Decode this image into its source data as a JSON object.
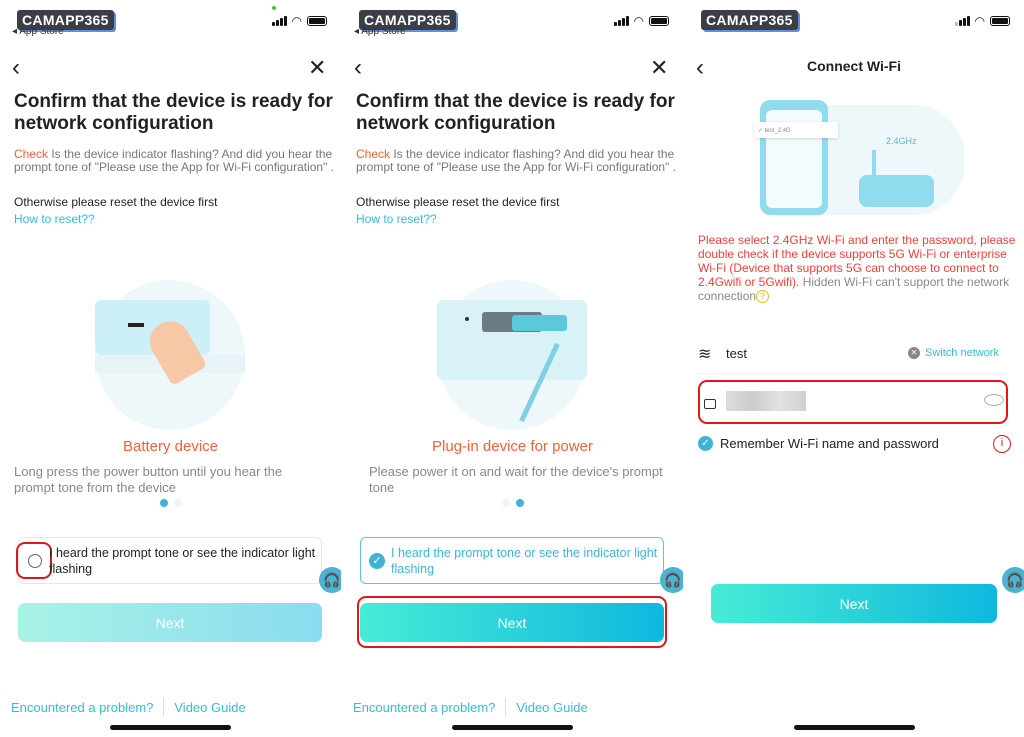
{
  "watermark": "CAMAPP365",
  "status": {
    "back_app": "App Store"
  },
  "panels": [
    {
      "title": "Confirm that the device is ready for network configuration",
      "check_word": "Check",
      "check_text": " Is the device indicator flashing? And did you hear the prompt tone of \"Please use the App for Wi-Fi configuration\" .",
      "otherwise": "Otherwise please reset the device first",
      "reset_link": "How to reset??",
      "device_title": "Battery device",
      "device_desc": "Long press the power button until you hear the prompt tone from the device",
      "page_index": 1,
      "page_count": 2,
      "confirm_label": "I heard the prompt tone or see the indicator light flashing",
      "confirm_checked": false,
      "next_label": "Next",
      "next_enabled": false,
      "problem_link": "Encountered a problem?",
      "video_link": "Video Guide"
    },
    {
      "title": "Confirm that the device is ready for network configuration",
      "check_word": "Check",
      "check_text": " Is the device indicator flashing? And did you hear the prompt tone of \"Please use the App for Wi-Fi configuration\" .",
      "otherwise": "Otherwise please reset the device first",
      "reset_link": "How to reset??",
      "device_title": "Plug-in device for power",
      "device_desc": "Please power it on and wait for the device's prompt tone",
      "page_index": 2,
      "page_count": 2,
      "confirm_label": "I heard the prompt tone or see the indicator light flashing",
      "confirm_checked": true,
      "next_label": "Next",
      "next_enabled": true,
      "problem_link": "Encountered a problem?",
      "video_link": "Video Guide"
    }
  ],
  "wifi": {
    "title": "Connect Wi-Fi",
    "illus_band": "2.4GHz",
    "illus_ssid": "test_2.4G",
    "warning_red": "Please select 2.4GHz Wi-Fi and enter the password, please double check if the device supports 5G Wi-Fi or enterprise Wi-Fi (Device that supports 5G can choose to connect to 2.4Gwifi or 5Gwifi).",
    "warning_gray": " Hidden Wi-Fi can't support the network connection",
    "ssid": "test",
    "switch_label": "Switch network",
    "remember_label": "Remember Wi-Fi name and password",
    "remember_checked": true,
    "next_label": "Next"
  },
  "colors": {
    "accent": "#3bb9d3",
    "orange": "#f0603a",
    "highlight": "#e0161b"
  }
}
